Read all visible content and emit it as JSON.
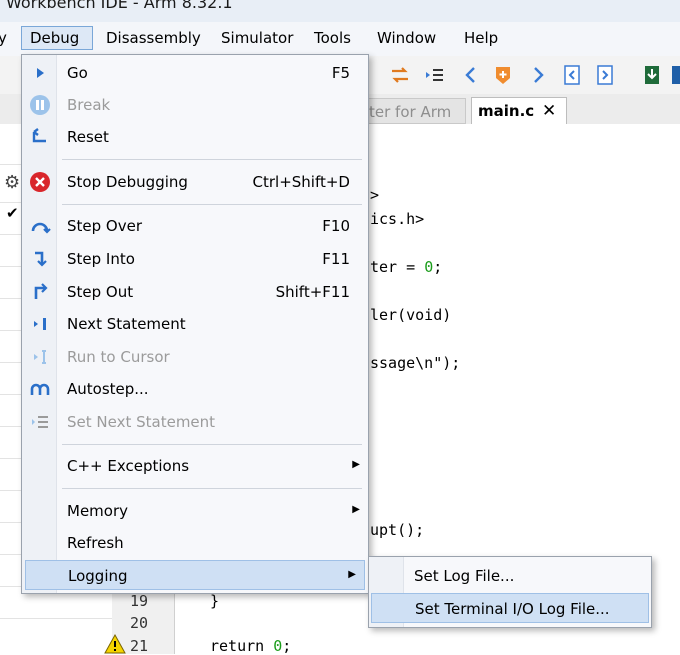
{
  "window": {
    "title": "Workbench IDE - Arm 8.32.1"
  },
  "menubar": {
    "items": [
      "y",
      "Debug",
      "Disassembly",
      "Simulator",
      "Tools",
      "Window",
      "Help"
    ]
  },
  "tabs": [
    {
      "label": "ter for Arm",
      "active": false
    },
    {
      "label": "main.c",
      "active": true,
      "close": "✕"
    }
  ],
  "debug_menu": {
    "items": [
      {
        "label": "Go",
        "shortcut": "F5",
        "icon": "play-icon",
        "enabled": true
      },
      {
        "label": "Break",
        "shortcut": "",
        "icon": "pause-icon",
        "enabled": false
      },
      {
        "label": "Reset",
        "shortcut": "",
        "icon": "reset-icon",
        "enabled": true
      },
      {
        "label": "Stop Debugging",
        "shortcut": "Ctrl+Shift+D",
        "icon": "stop-icon",
        "enabled": true
      },
      {
        "label": "Step Over",
        "shortcut": "F10",
        "icon": "step-over-icon",
        "enabled": true
      },
      {
        "label": "Step Into",
        "shortcut": "F11",
        "icon": "step-into-icon",
        "enabled": true
      },
      {
        "label": "Step Out",
        "shortcut": "Shift+F11",
        "icon": "step-out-icon",
        "enabled": true
      },
      {
        "label": "Next Statement",
        "shortcut": "",
        "icon": "next-statement-icon",
        "enabled": true
      },
      {
        "label": "Run to Cursor",
        "shortcut": "",
        "icon": "run-to-cursor-icon",
        "enabled": false
      },
      {
        "label": "Autostep...",
        "shortcut": "",
        "icon": "autostep-icon",
        "enabled": true
      },
      {
        "label": "Set Next Statement",
        "shortcut": "",
        "icon": "set-next-statement-icon",
        "enabled": false
      },
      {
        "label": "C++ Exceptions",
        "shortcut": "",
        "submenu": true,
        "enabled": true
      },
      {
        "label": "Memory",
        "shortcut": "",
        "submenu": true,
        "enabled": true
      },
      {
        "label": "Refresh",
        "shortcut": "",
        "enabled": true
      },
      {
        "label": "Logging",
        "shortcut": "",
        "submenu": true,
        "enabled": true,
        "highlighted": true
      }
    ]
  },
  "logging_submenu": {
    "items": [
      {
        "label": "Set Log File..."
      },
      {
        "label": "Set Terminal I/O Log File...",
        "highlighted": true
      }
    ]
  },
  "editor": {
    "code_fragments": [
      ">",
      "ics.h>",
      "ter = ",
      "0",
      ";",
      "ler(void)",
      "ssage\\n\");",
      "upt();",
      "}",
      "return ",
      "0",
      ";"
    ],
    "line_numbers": [
      "19",
      "20",
      "21"
    ]
  },
  "colors": {
    "accent": "#cfe0f4",
    "menu_bg": "#f7f8fb",
    "number_literal": "#1a9c1a"
  }
}
